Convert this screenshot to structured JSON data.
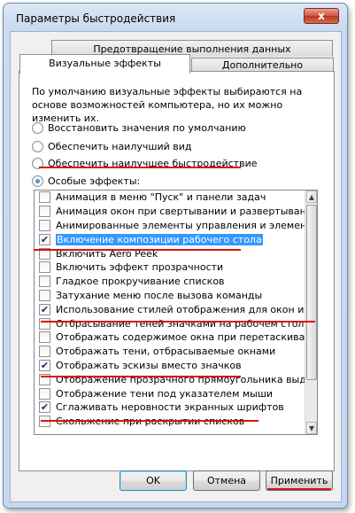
{
  "window": {
    "title": "Параметры быстродействия",
    "close_symbol": "x"
  },
  "tabs": {
    "top": [
      {
        "label": "Предотвращение выполнения данных"
      }
    ],
    "bottom": [
      {
        "label": "Визуальные эффекты",
        "active": true
      },
      {
        "label": "Дополнительно",
        "active": false
      }
    ]
  },
  "description": "По умолчанию визуальные эффекты выбираются на основе возможностей компьютера, но их можно изменить их.",
  "radios": [
    {
      "label": "Восстановить значения по умолчанию",
      "checked": false
    },
    {
      "label": "Обеспечить наилучший вид",
      "checked": false
    },
    {
      "label": "Обеспечить наилучшее быстродействие",
      "checked": false
    },
    {
      "label": "Особые эффекты:",
      "checked": true
    }
  ],
  "effects": [
    {
      "label": "Анимация в меню \"Пуск\" и панели задач",
      "checked": false
    },
    {
      "label": "Анимация окон при свертывании и развертывании",
      "checked": false
    },
    {
      "label": "Анимированные элементы управления и элементы внутри",
      "checked": false
    },
    {
      "label": "Включение композиции рабочего стола",
      "checked": true,
      "selected": true
    },
    {
      "label": "Включить Aero Peek",
      "checked": false
    },
    {
      "label": "Включить эффект прозрачности",
      "checked": false
    },
    {
      "label": "Гладкое прокручивание списков",
      "checked": false
    },
    {
      "label": "Затухание меню после вызова команды",
      "checked": false
    },
    {
      "label": "Использование стилей отображения для окон и кнопок",
      "checked": true
    },
    {
      "label": "Отбрасывание теней значками на рабочем столе",
      "checked": false
    },
    {
      "label": "Отображать содержимое окна при перетаскивании",
      "checked": false
    },
    {
      "label": "Отображать тени, отбрасываемые окнами",
      "checked": false
    },
    {
      "label": "Отображать эскизы вместо значков",
      "checked": true
    },
    {
      "label": "Отображение прозрачного прямоугольника выделения",
      "checked": false
    },
    {
      "label": "Отображение тени под указателем мыши",
      "checked": false
    },
    {
      "label": "Сглаживать неровности экранных шрифтов",
      "checked": true
    },
    {
      "label": "Скольжение при раскрытии списков",
      "checked": false
    }
  ],
  "checkmark": "✔",
  "scroll": {
    "up": "▲",
    "down": "▼"
  },
  "buttons": {
    "ok": "OK",
    "cancel": "Отмена",
    "apply": "Применить"
  },
  "accent_colors": {
    "selection": "#3399ff",
    "annotation": "#e01010"
  }
}
